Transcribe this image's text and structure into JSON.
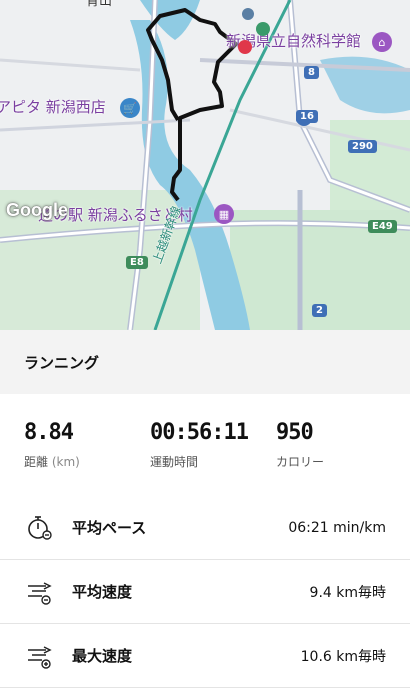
{
  "map": {
    "labels": {
      "museum": "新潟県立自然科学館",
      "store": "アピタ 新潟西店",
      "roadside": "道の駅 新潟ふるさと村",
      "line": "上越新幹線",
      "top_partial": "青山"
    },
    "shields": {
      "r8": "8",
      "r16": "16",
      "r290": "290",
      "e49": "E49",
      "e8": "E8",
      "r2": "2"
    },
    "watermark": "Google"
  },
  "activity": {
    "title": "ランニング"
  },
  "stats": [
    {
      "value": "8.84",
      "label": "距離",
      "unit": "(km)"
    },
    {
      "value": "00:56:11",
      "label": "運動時間",
      "unit": ""
    },
    {
      "value": "950",
      "label": "カロリー",
      "unit": ""
    }
  ],
  "rows": [
    {
      "name": "平均ペース",
      "value": "06:21 min/km",
      "icon": "stopwatch-icon"
    },
    {
      "name": "平均速度",
      "value": "9.4 km毎時",
      "icon": "speed-average-icon"
    },
    {
      "name": "最大速度",
      "value": "10.6 km毎時",
      "icon": "speed-max-icon"
    }
  ]
}
